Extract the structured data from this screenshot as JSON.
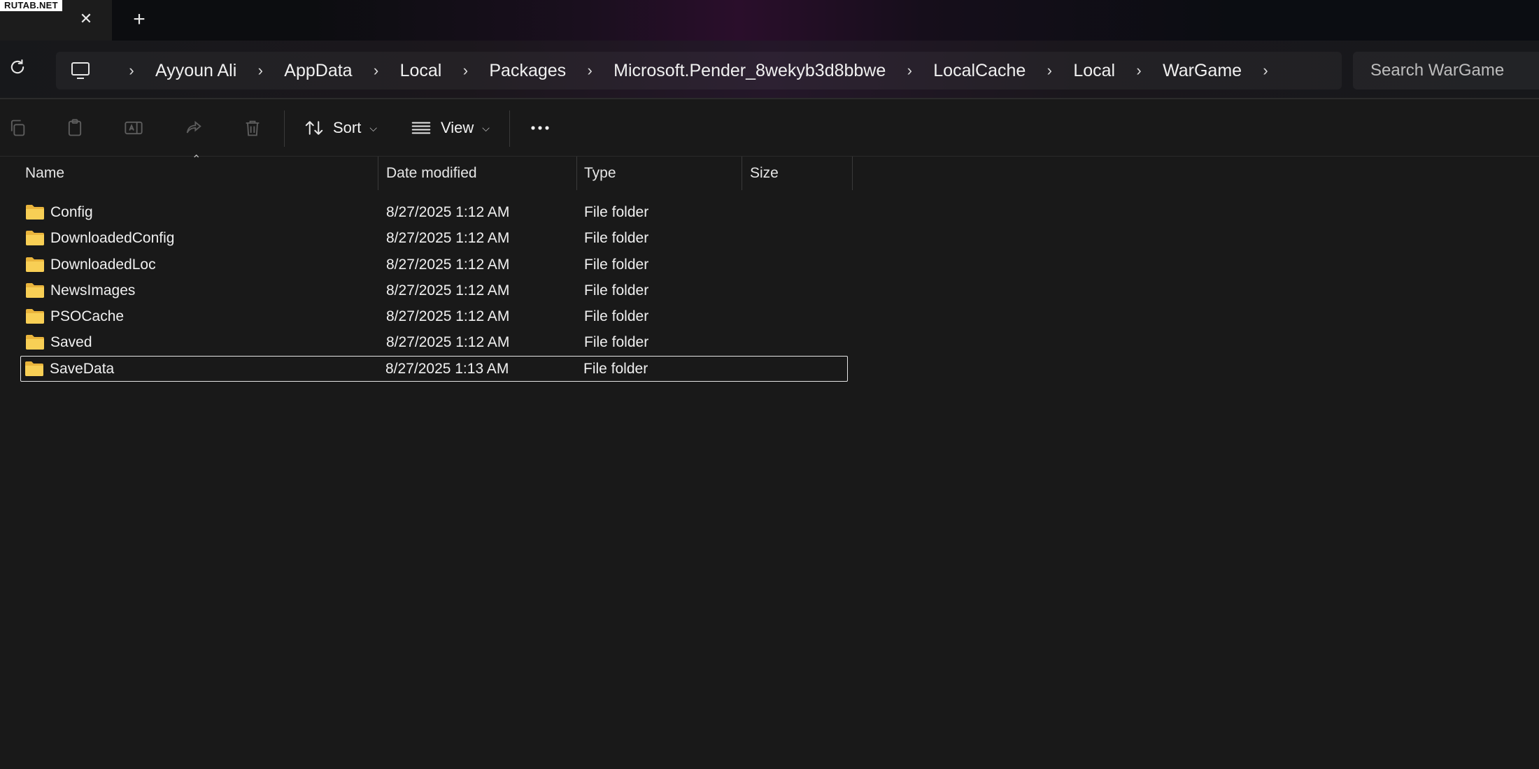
{
  "watermark": "RUTAB.NET",
  "titlebar": {
    "tab_close_icon": "close-icon",
    "new_tab_icon": "plus-icon"
  },
  "address": {
    "refresh_icon": "refresh-icon",
    "root_icon": "computer-icon",
    "crumbs": [
      "Ayyoun Ali",
      "AppData",
      "Local",
      "Packages",
      "Microsoft.Pender_8wekyb3d8bbwe",
      "LocalCache",
      "Local",
      "WarGame"
    ],
    "search_placeholder": "Search WarGame"
  },
  "toolbar": {
    "icons": [
      "copy-icon",
      "paste-icon",
      "rename-icon",
      "share-icon",
      "delete-icon"
    ],
    "sort_label": "Sort",
    "view_label": "View",
    "more_icon": "more-icon"
  },
  "columns": {
    "name": "Name",
    "date": "Date modified",
    "type": "Type",
    "size": "Size"
  },
  "files": [
    {
      "name": "Config",
      "date": "8/27/2025 1:12 AM",
      "type": "File folder",
      "size": ""
    },
    {
      "name": "DownloadedConfig",
      "date": "8/27/2025 1:12 AM",
      "type": "File folder",
      "size": ""
    },
    {
      "name": "DownloadedLoc",
      "date": "8/27/2025 1:12 AM",
      "type": "File folder",
      "size": ""
    },
    {
      "name": "NewsImages",
      "date": "8/27/2025 1:12 AM",
      "type": "File folder",
      "size": ""
    },
    {
      "name": "PSOCache",
      "date": "8/27/2025 1:12 AM",
      "type": "File folder",
      "size": ""
    },
    {
      "name": "Saved",
      "date": "8/27/2025 1:12 AM",
      "type": "File folder",
      "size": ""
    },
    {
      "name": "SaveData",
      "date": "8/27/2025 1:13 AM",
      "type": "File folder",
      "size": "",
      "selected": true
    }
  ],
  "colors": {
    "background": "#191919",
    "folder": "#f5c64b",
    "text": "#f0f0f0"
  }
}
